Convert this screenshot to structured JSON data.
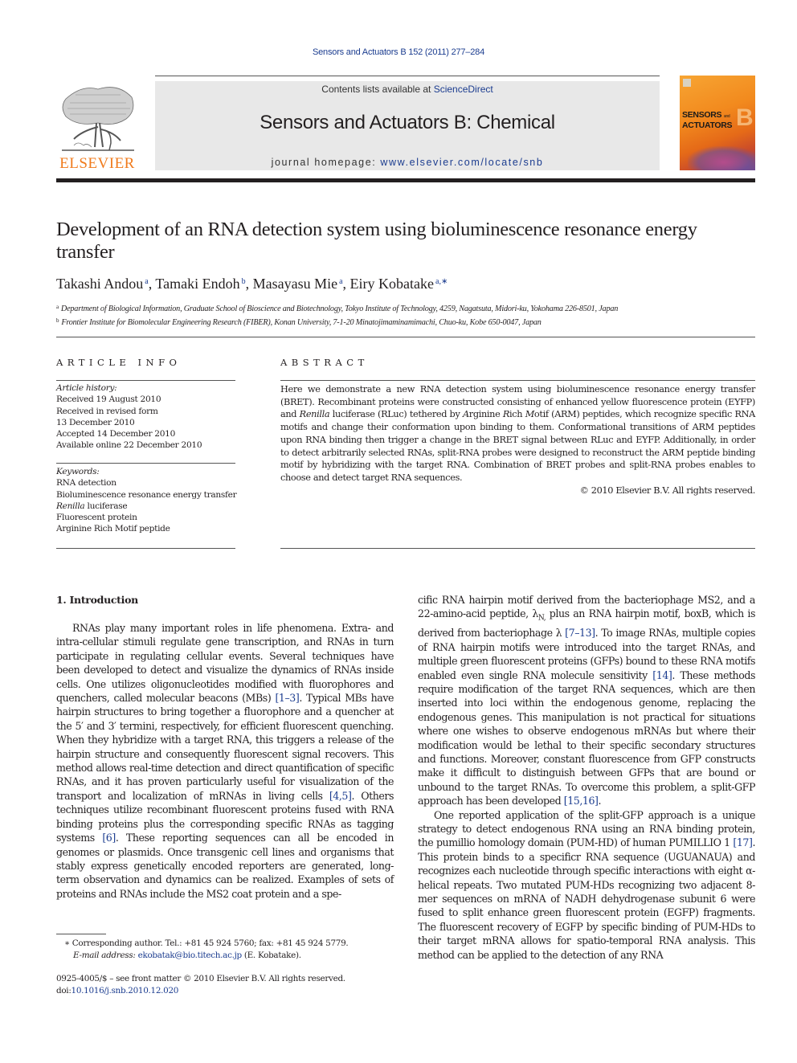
{
  "header": {
    "citation": "Sensors and Actuators B 152 (2011) 277–284",
    "contents_prefix": "Contents lists available at ",
    "contents_link": "ScienceDirect",
    "journal_title": "Sensors and Actuators B: Chemical",
    "homepage_prefix": "journal homepage: ",
    "homepage_link": "www.elsevier.com/locate/snb",
    "publisher_logo_text": "ELSEVIER",
    "cover_line1": "SENSORS",
    "cover_and": "and",
    "cover_line2": "ACTUATORS",
    "cover_letter": "B"
  },
  "article": {
    "title": "Development of an RNA detection system using bioluminescence resonance energy transfer",
    "authors": [
      {
        "name": "Takashi Andou",
        "sup": "a"
      },
      {
        "name": "Tamaki Endoh",
        "sup": "b"
      },
      {
        "name": "Masayasu Mie",
        "sup": "a"
      },
      {
        "name": "Eiry Kobatake",
        "sup": "a,∗"
      }
    ],
    "author_separator": ", ",
    "affiliations": [
      {
        "mark": "a",
        "text": "Department of Biological Information, Graduate School of Bioscience and Biotechnology, Tokyo Institute of Technology, 4259, Nagatsuta, Midori-ku, Yokohama 226-8501, Japan"
      },
      {
        "mark": "b",
        "text": "Frontier Institute for Biomolecular Engineering Research (FIBER), Konan University, 7-1-20 Minatojimaminamimachi, Chuo-ku, Kobe 650-0047, Japan"
      }
    ]
  },
  "article_info": {
    "heading": "ARTICLE INFO",
    "history_label": "Article history:",
    "history": [
      "Received 19 August 2010",
      "Received in revised form",
      "13 December 2010",
      "Accepted 14 December 2010",
      "Available online 22 December 2010"
    ],
    "keywords_label": "Keywords:",
    "keywords": [
      {
        "pre": "",
        "italic": "",
        "post": "RNA detection"
      },
      {
        "pre": "",
        "italic": "",
        "post": "Bioluminescence resonance energy transfer"
      },
      {
        "pre": "",
        "italic": "Renilla",
        "post": " luciferase"
      },
      {
        "pre": "",
        "italic": "",
        "post": "Fluorescent protein"
      },
      {
        "pre": "",
        "italic": "",
        "post": "Arginine Rich Motif peptide"
      }
    ]
  },
  "abstract": {
    "heading": "ABSTRACT",
    "segments": [
      {
        "t": "Here we demonstrate a new RNA detection system using bioluminescence resonance energy transfer (BRET). Recombinant proteins were constructed consisting of enhanced yellow fluorescence protein (EYFP) and ",
        "i": false
      },
      {
        "t": "Renilla",
        "i": true
      },
      {
        "t": " luciferase (RLuc) tethered by ",
        "i": false
      },
      {
        "t": "A",
        "i": true
      },
      {
        "t": "rginine ",
        "i": false
      },
      {
        "t": "R",
        "i": true
      },
      {
        "t": "ich ",
        "i": false
      },
      {
        "t": "M",
        "i": true
      },
      {
        "t": "otif (ARM) peptides, which recognize specific RNA motifs and change their conformation upon binding to them. Conformational transitions of ARM peptides upon RNA binding then trigger a change in the BRET signal between RLuc and EYFP. Additionally, in order to detect arbitrarily selected RNAs, split-RNA probes were designed to reconstruct the ARM peptide binding motif by hybridizing with the target RNA. Combination of BRET probes and split-RNA probes enables to choose and detect target RNA sequences.",
        "i": false
      }
    ],
    "copyright": "© 2010 Elsevier B.V. All rights reserved."
  },
  "body": {
    "section_heading": "1.  Introduction",
    "left_column": [
      {
        "t": "RNAs play many important roles in life phenomena. Extra- and intra-cellular stimuli regulate gene transcription, and RNAs in turn participate in regulating cellular events. Several techniques have been developed to detect and visualize the dynamics of RNAs inside cells. One utilizes oligonucleotides modified with fluorophores and quenchers, called molecular beacons (MBs) ",
        "link": false
      },
      {
        "t": "[1–3]",
        "link": true
      },
      {
        "t": ". Typical MBs have hairpin structures to bring together a fluorophore and a quencher at the 5′ and 3′ termini, respectively, for efficient fluorescent quenching. When they hybridize with a target RNA, this triggers a release of the hairpin structure and consequently fluorescent signal recovers. This method allows real-time detection and direct quantification of specific RNAs, and it has proven particularly useful for visualization of the transport and localization of mRNAs in living cells ",
        "link": false
      },
      {
        "t": "[4,5]",
        "link": true
      },
      {
        "t": ". Others techniques utilize recombinant fluorescent proteins fused with RNA binding proteins plus the corresponding specific RNAs as tagging systems ",
        "link": false
      },
      {
        "t": "[6]",
        "link": true
      },
      {
        "t": ". These reporting sequences can all be encoded in genomes or plasmids. Once transgenic cell lines and organisms that stably express genetically encoded reporters are generated, long-term observation and dynamics can be realized. Examples of sets of proteins and RNAs include the MS2 coat protein and a spe-",
        "link": false
      }
    ],
    "right_column_p1": [
      {
        "t": "cific RNA hairpin motif derived from the bacteriophage MS2, and a 22-amino-acid peptide, λ",
        "link": false
      },
      {
        "t": "N,",
        "sub": true
      },
      {
        "t": " plus an RNA hairpin motif, boxB, which is derived from bacteriophage λ ",
        "link": false
      },
      {
        "t": "[7–13]",
        "link": true
      },
      {
        "t": ". To image RNAs, multiple copies of RNA hairpin motifs were introduced into the target RNAs, and multiple green fluorescent proteins (GFPs) bound to these RNA motifs enabled even single RNA molecule sensitivity ",
        "link": false
      },
      {
        "t": "[14]",
        "link": true
      },
      {
        "t": ". These methods require modification of the target RNA sequences, which are then inserted into loci within the endogenous genome, replacing the endogenous genes. This manipulation is not practical for situations where one wishes to observe endogenous mRNAs but where their modification would be lethal to their specific secondary structures and functions. Moreover, constant fluorescence from GFP constructs make it difficult to distinguish between GFPs that are bound or unbound to the target RNAs. To overcome this problem, a split-GFP approach has been developed ",
        "link": false
      },
      {
        "t": "[15,16]",
        "link": true
      },
      {
        "t": ".",
        "link": false
      }
    ],
    "right_column_p2": [
      {
        "t": "One reported application of the split-GFP approach is a unique strategy to detect endogenous RNA using an RNA binding protein, the pumillio homology domain (PUM-HD) of human PUMILLIO 1 ",
        "link": false
      },
      {
        "t": "[17]",
        "link": true
      },
      {
        "t": ". This protein binds to a specificr RNA sequence (UGUANAUA) and recognizes each nucleotide through specific interactions with eight α-helical repeats. Two mutated PUM-HDs recognizing two adjacent 8-mer sequences on mRNA of NADH dehydrogenase subunit 6 were fused to split enhance green fluorescent protein (EGFP) fragments. The fluorescent recovery of EGFP by specific binding of PUM-HDs to their target mRNA allows for spatio-temporal RNA analysis. This method can be applied to the detection of any RNA",
        "link": false
      }
    ]
  },
  "footnote": {
    "marker": "∗",
    "corresponding": " Corresponding author. Tel.: +81 45 924 5760; fax: +81 45 924 5779.",
    "email_label": "E-mail address:",
    "email": "ekobatak@bio.titech.ac.jp",
    "email_suffix": " (E. Kobatake)."
  },
  "front_matter": {
    "issn_line": "0925-4005/$ – see front matter © 2010 Elsevier B.V. All rights reserved.",
    "doi_prefix": "doi:",
    "doi": "10.1016/j.snb.2010.12.020"
  },
  "colors": {
    "link": "#1b3c8f",
    "elsevier_orange": "#f07b1d",
    "journal_box_bg": "#e8e8e8",
    "text": "#231f20"
  }
}
